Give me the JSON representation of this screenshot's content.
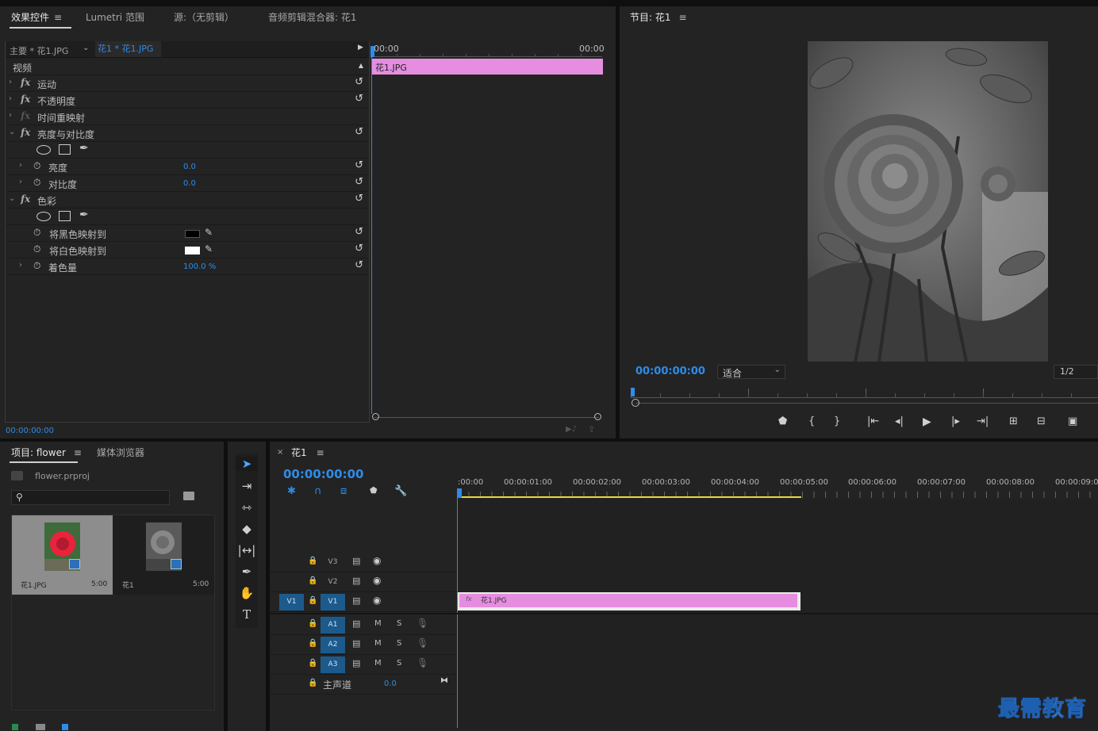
{
  "effect_controls": {
    "tabs": [
      "效果控件",
      "Lumetri 范围",
      "源:（无剪辑）",
      "音频剪辑混合器: 花1"
    ],
    "menu_icon": "≡",
    "master_label": "主要 * 花1.JPG",
    "clip_selector": "花1 * 花1.JPG",
    "timeline_start": "00:00",
    "timeline_end": "00:00",
    "clip_bar_label": "花1.JPG",
    "section_video": "视频",
    "rows": {
      "motion": "运动",
      "opacity": "不透明度",
      "time_remap": "时间重映射",
      "brightness_contrast": "亮度与对比度",
      "brightness": "亮度",
      "brightness_value": "0.0",
      "contrast": "对比度",
      "contrast_value": "0.0",
      "tint": "色彩",
      "map_black": "将黑色映射到",
      "map_white": "将白色映射到",
      "amount": "着色量",
      "amount_value": "100.0 %"
    },
    "timecode": "00:00:00:00"
  },
  "program_monitor": {
    "title": "节目: 花1",
    "timecode": "00:00:00:00",
    "fit_select": "适合",
    "resolution": "1/2"
  },
  "project": {
    "tabs": [
      "项目: flower",
      "媒体浏览器"
    ],
    "file_name": "flower.prproj",
    "items": [
      {
        "name": "花1.JPG",
        "duration": "5:00"
      },
      {
        "name": "花1",
        "duration": "5:00"
      }
    ]
  },
  "timeline": {
    "sequence_name": "花1",
    "timecode": "00:00:00:00",
    "ruler": [
      ":00:00",
      "00:00:01:00",
      "00:00:02:00",
      "00:00:03:00",
      "00:00:04:00",
      "00:00:05:00",
      "00:00:06:00",
      "00:00:07:00",
      "00:00:08:00",
      "00:00:09:00"
    ],
    "video_tracks": [
      "V3",
      "V2",
      "V1"
    ],
    "source_patch": "V1",
    "audio_tracks": [
      "A1",
      "A2",
      "A3"
    ],
    "mute_label": "M",
    "solo_label": "S",
    "master_track": "主声道",
    "master_value": "0.0",
    "clip_label": "花1.JPG"
  },
  "watermark": "最需教育",
  "colors": {
    "accent_blue": "#2d8ceb",
    "clip_pink": "#e58ee0",
    "in_out_yellow": "#e8d93a",
    "panel_bg": "#232323"
  }
}
